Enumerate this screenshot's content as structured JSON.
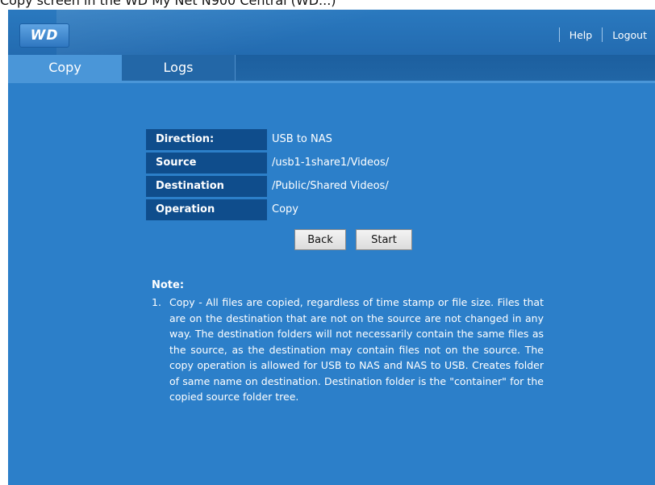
{
  "caption": "Copy screen in the WD My Net N900 Central (WD...)",
  "header": {
    "logo": "WD",
    "help": "Help",
    "logout": "Logout"
  },
  "tabs": [
    {
      "label": "Copy",
      "active": true
    },
    {
      "label": "Logs",
      "active": false
    }
  ],
  "details": [
    {
      "label": "Direction:",
      "value": "USB to NAS"
    },
    {
      "label": "Source",
      "value": "/usb1-1share1/Videos/"
    },
    {
      "label": "Destination",
      "value": "/Public/Shared Videos/"
    },
    {
      "label": "Operation",
      "value": "Copy"
    }
  ],
  "buttons": {
    "back": "Back",
    "start": "Start"
  },
  "note": {
    "title": "Note:",
    "items": [
      {
        "number": "1.",
        "text": "Copy - All files are copied, regardless of time stamp or file size. Files that are on the destination that are not on the source are not changed in any way. The destination folders will not necessarily contain the same files as the source, as the destination may contain files not on the source. The copy operation is allowed for USB to NAS and NAS to USB. Creates folder of same name on destination. Destination folder is the \"container\" for the copied source folder tree."
      }
    ]
  },
  "colors": {
    "background": "#2c7fc9",
    "header": "#236bb0",
    "active_tab": "#4a96d8",
    "label_cell": "#0f4d8c"
  }
}
